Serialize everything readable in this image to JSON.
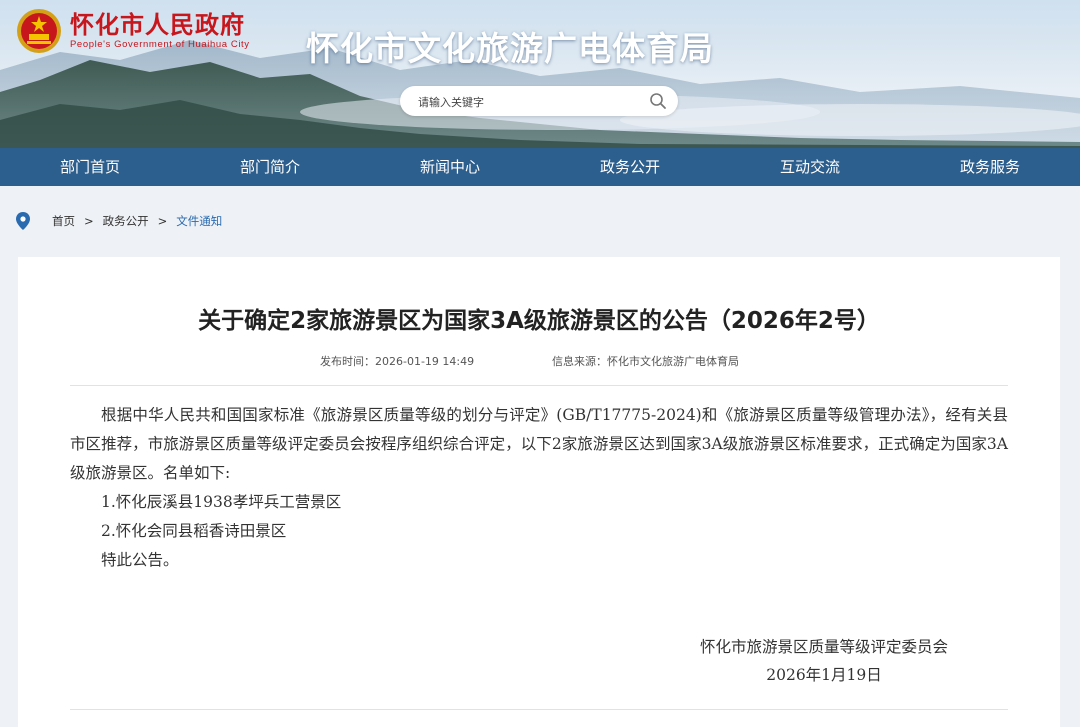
{
  "header": {
    "logo_cn": "怀化市人民政府",
    "logo_en": "People's Government of Huaihua City",
    "site_title": "怀化市文化旅游广电体育局",
    "search_placeholder": "请输入关键字",
    "brand_color": "#c8161d"
  },
  "nav": {
    "color": "#2d5f8e",
    "items": [
      "部门首页",
      "部门简介",
      "新闻中心",
      "政务公开",
      "互动交流",
      "政务服务"
    ]
  },
  "breadcrumb": {
    "items": [
      "首页",
      "政务公开"
    ],
    "current": "文件通知",
    "separator": ">"
  },
  "article": {
    "title": "关于确定2家旅游景区为国家3A级旅游景区的公告（2026年2号）",
    "publish_time": "发布时间：2026-01-19 14:49",
    "source": "信息来源：怀化市文化旅游广电体育局",
    "paragraph": "根据中华人民共和国国家标准《旅游景区质量等级的划分与评定》(GB/T17775-2024)和《旅游景区质量等级管理办法》，经有关县市区推荐，市旅游景区质量等级评定委员会按程序组织综合评定，以下2家旅游景区达到国家3A级旅游景区标准要求，正式确定为国家3A级旅游景区。名单如下:",
    "list": [
      "1.怀化辰溪县1938孝坪兵工营景区",
      "2.怀化会同县稻香诗田景区"
    ],
    "closing": "特此公告。",
    "signature_org": "怀化市旅游景区质量等级评定委员会",
    "signature_date": "2026年1月19日"
  }
}
